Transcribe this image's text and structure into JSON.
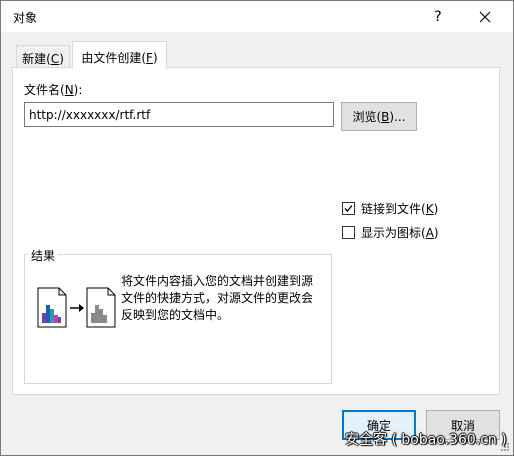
{
  "window": {
    "title": "对象",
    "help_label": "?",
    "close_label": "close"
  },
  "tabs": [
    {
      "label": "新建(",
      "key": "C",
      "suffix": ")",
      "selected": false
    },
    {
      "label": "由文件创建(",
      "key": "F",
      "suffix": ")",
      "selected": true
    }
  ],
  "file": {
    "label_prefix": "文件名(",
    "label_key": "N",
    "label_suffix": "):",
    "value": "http://xxxxxxx/rtf.rtf",
    "browse_prefix": "浏览(",
    "browse_key": "B",
    "browse_suffix": ")..."
  },
  "options": {
    "link": {
      "prefix": "链接到文件(",
      "key": "K",
      "suffix": ")",
      "checked": true
    },
    "display_icon": {
      "prefix": "显示为图标(",
      "key": "A",
      "suffix": ")",
      "checked": false
    }
  },
  "result": {
    "title": "结果",
    "line1": "将文件内容插入您的文档并创建到源",
    "line2": "文件的快捷方式，对源文件的更改会",
    "line3": "反映到您的文档中。"
  },
  "buttons": {
    "ok": "确定",
    "cancel": "取消"
  },
  "watermark": "安全客 ( bobao.360.cn )",
  "colors": {
    "accent": "#0078d7",
    "doc_bar_purple": "#7b3fa0",
    "doc_bar_blue": "#1e5cc8",
    "doc_bar_teal": "#2aa198",
    "doc_bar_magenta": "#c03cc0",
    "doc_bar_gray": "#8a8a8a"
  }
}
